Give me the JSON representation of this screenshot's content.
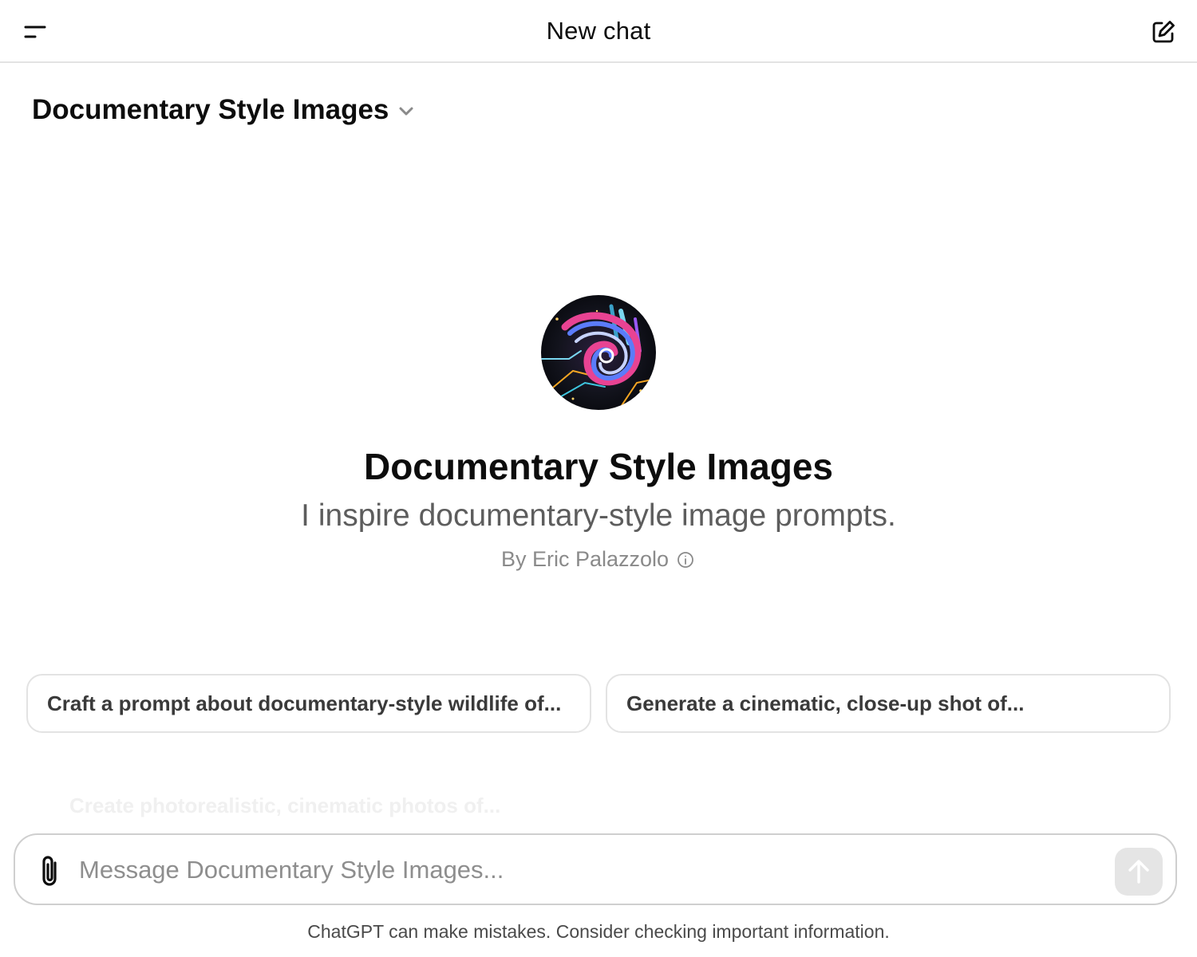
{
  "header": {
    "title": "New chat",
    "menu_icon": "sidebar-toggle-icon",
    "new_chat_icon": "edit-icon"
  },
  "model_switcher": {
    "label": "Documentary Style Images",
    "icon": "chevron-down-icon"
  },
  "gpt": {
    "name": "Documentary Style Images",
    "description": "I inspire documentary-style image prompts.",
    "author": "By Eric Palazzolo",
    "info_icon": "info-icon"
  },
  "starters": [
    "Craft a prompt about documentary-style wildlife of...",
    "Generate a cinematic, close-up shot of...",
    "Create photorealistic, cinematic photos of..."
  ],
  "composer": {
    "placeholder": "Message Documentary Style Images...",
    "attach_icon": "paperclip-icon",
    "send_icon": "arrow-up-icon"
  },
  "disclaimer": "ChatGPT can make mistakes. Consider checking important information.",
  "colors": {
    "text": "#0d0d0d",
    "muted": "#5d5d5d",
    "border": "#e3e3e3",
    "send_disabled": "#e5e5e5"
  }
}
